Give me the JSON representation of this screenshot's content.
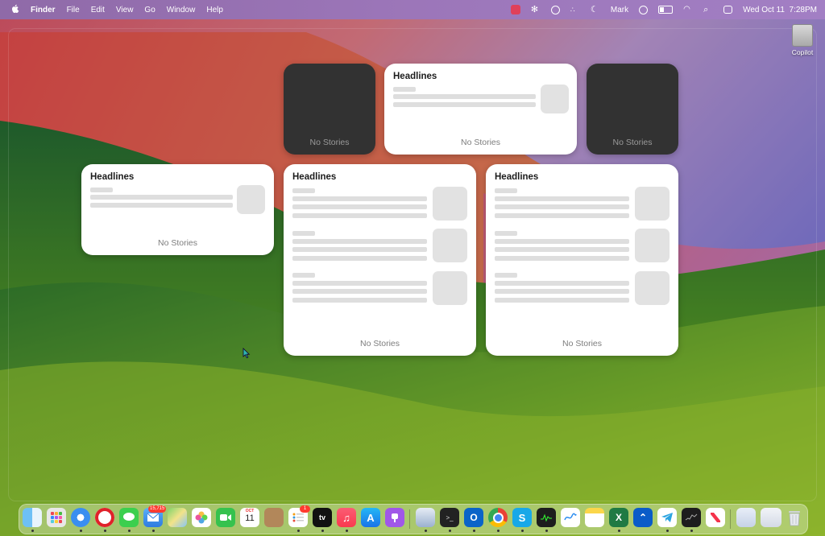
{
  "menubar": {
    "apple": "",
    "app_name": "Finder",
    "menus": [
      "File",
      "Edit",
      "View",
      "Go",
      "Window",
      "Help"
    ],
    "user": "Mark",
    "datetime": "Wed Oct 11  7:28PM"
  },
  "desktop": {
    "icon_label": "Copilot"
  },
  "widgets": {
    "headline_title": "Headlines",
    "no_stories": "No Stories"
  },
  "dock": {
    "mail_badge": "15,715",
    "reminders_badge": "1",
    "calendar_month": "OCT",
    "calendar_day": "11",
    "tv_label": "tv"
  },
  "colors": {
    "widget_dark": "#323232",
    "widget_light": "#ffffff",
    "placeholder": "#dedede"
  }
}
